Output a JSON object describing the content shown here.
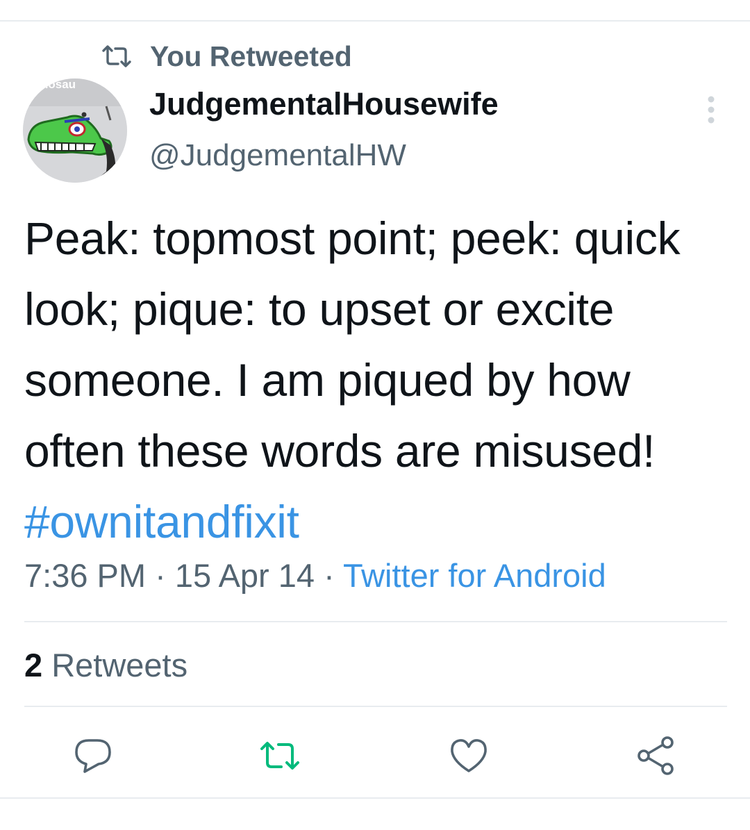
{
  "retweet_context": {
    "icon": "retweet-icon",
    "label": "You Retweeted"
  },
  "author": {
    "display_name": "JudgementalHousewife",
    "handle": "@JudgementalHW",
    "avatar_text": "nosau"
  },
  "tweet": {
    "text": "Peak: topmost point; peek: quick look; pique: to upset or excite someone.  I am piqued by how often these words are misused! ",
    "hashtag": "#ownitandfixit",
    "time": "7:36 PM",
    "separator_1": " · ",
    "date": "15 Apr 14",
    "separator_2": " · ",
    "source": "Twitter for Android"
  },
  "stats": {
    "retweets_count": "2",
    "retweets_label": " Retweets"
  },
  "actions": [
    {
      "name": "reply",
      "icon": "reply-icon"
    },
    {
      "name": "retweet",
      "icon": "retweet-icon",
      "active": true
    },
    {
      "name": "like",
      "icon": "heart-icon"
    },
    {
      "name": "share",
      "icon": "share-icon"
    }
  ],
  "colors": {
    "text_primary": "#0f1419",
    "text_secondary": "#536471",
    "link": "#3a94e4",
    "retweet_active": "#00ba7c",
    "divider": "#e8ecef"
  }
}
